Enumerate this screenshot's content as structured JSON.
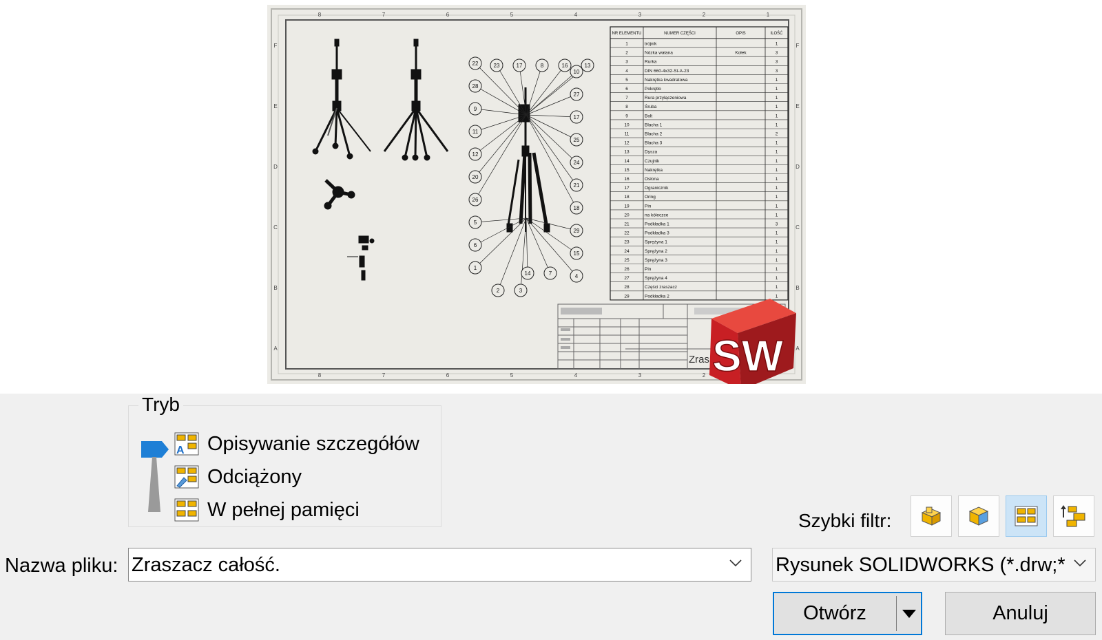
{
  "preview": {
    "logo_text": "SW",
    "title_block_text": "Zras",
    "bom_headers": [
      "NR ELEMENTU",
      "NUMER CZĘŚCI",
      "OPIS",
      "ILOŚĆ"
    ],
    "bom_rows": [
      [
        "1",
        "trójnik",
        "",
        "1"
      ],
      [
        "2",
        "Nózka wałana",
        "Kołek",
        "3"
      ],
      [
        "3",
        "Rurka",
        "",
        "3"
      ],
      [
        "4",
        "DIN 660-4x32-St-A-23",
        "",
        "3"
      ],
      [
        "5",
        "Nakrętka kwadratowa",
        "",
        "1"
      ],
      [
        "6",
        "Pokrętło",
        "",
        "1"
      ],
      [
        "7",
        "Rura przyłączeniowa",
        "",
        "1"
      ],
      [
        "8",
        "Śruba",
        "",
        "1"
      ],
      [
        "9",
        "Bolt",
        "",
        "1"
      ],
      [
        "10",
        "Blacha 1",
        "",
        "1"
      ],
      [
        "11",
        "Blacha 2",
        "",
        "2"
      ],
      [
        "12",
        "Blacha 3",
        "",
        "1"
      ],
      [
        "13",
        "Dysza",
        "",
        "1"
      ],
      [
        "14",
        "Czujnik",
        "",
        "1"
      ],
      [
        "15",
        "Nakrętka",
        "",
        "1"
      ],
      [
        "16",
        "Osłona",
        "",
        "1"
      ],
      [
        "17",
        "Ogranicznik",
        "",
        "1"
      ],
      [
        "18",
        "Oring",
        "",
        "1"
      ],
      [
        "19",
        "Pin",
        "",
        "1"
      ],
      [
        "20",
        "na kółeczce",
        "",
        "1"
      ],
      [
        "21",
        "Podkładka 1",
        "",
        "3"
      ],
      [
        "22",
        "Podkładka 3",
        "",
        "1"
      ],
      [
        "23",
        "Sprężyna 1",
        "",
        "1"
      ],
      [
        "24",
        "Sprężyna 2",
        "",
        "1"
      ],
      [
        "25",
        "Sprężyna 3",
        "",
        "1"
      ],
      [
        "26",
        "Pin",
        "",
        "1"
      ],
      [
        "27",
        "Sprężyna 4",
        "",
        "1"
      ],
      [
        "28",
        "Części zraszacz",
        "",
        "1"
      ],
      [
        "29",
        "Podkładka 2",
        "",
        "1"
      ]
    ],
    "border_numbers": [
      "8",
      "7",
      "6",
      "5",
      "4",
      "3",
      "2",
      "1"
    ],
    "border_letters": [
      "F",
      "E",
      "D",
      "C",
      "B",
      "A"
    ],
    "balloons_left": [
      "22",
      "28",
      "9",
      "11",
      "12",
      "20",
      "26",
      "5",
      "6",
      "1",
      "2",
      "3"
    ],
    "balloons_top": [
      "23",
      "17",
      "8",
      "16",
      "13"
    ],
    "balloons_right": [
      "10",
      "27",
      "17",
      "25",
      "24",
      "21",
      "18",
      "29",
      "15",
      "4"
    ],
    "balloons_bottom": [
      "14",
      "7"
    ]
  },
  "mode_group": {
    "title": "Tryb",
    "options": [
      {
        "label": "Opisywanie szczegółów",
        "selected": true
      },
      {
        "label": "Odciążony",
        "selected": false
      },
      {
        "label": "W pełnej pamięci",
        "selected": false
      }
    ]
  },
  "quick_filter": {
    "label": "Szybki filtr:",
    "buttons": [
      {
        "icon": "part-filter-icon",
        "active": false
      },
      {
        "icon": "assembly-filter-icon",
        "active": false
      },
      {
        "icon": "drawing-filter-icon",
        "active": true
      },
      {
        "icon": "top-level-assembly-filter-icon",
        "active": false
      }
    ]
  },
  "file_name": {
    "label": "Nazwa pliku:",
    "value": "Zraszacz całość."
  },
  "file_type": {
    "value": "Rysunek SOLIDWORKS (*.drw;*.s"
  },
  "buttons": {
    "open": "Otwórz",
    "cancel": "Anuluj"
  },
  "colors": {
    "accent": "#0078d7",
    "dialog_bg": "#f0f0f0",
    "logo_red": "#d6262a",
    "selected_filter": "#cce4f7"
  }
}
